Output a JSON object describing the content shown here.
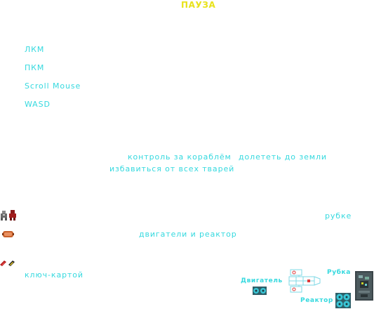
{
  "title": "ПАУЗА",
  "controls": [
    {
      "key": "ЛКМ"
    },
    {
      "key": "ПКМ"
    },
    {
      "key": "Scroll Mouse"
    },
    {
      "key": "WASD"
    }
  ],
  "goals": {
    "control": "контроль за кораблём",
    "fly": "долететь до земли",
    "kill": "избавиться от всех тварей"
  },
  "hints": {
    "cabin": "рубке",
    "engines": "двигатели и реактор",
    "keycard": "ключ-картой"
  },
  "diagram": {
    "engine_label": "Двигатель",
    "cabin_label": "Рубка",
    "reactor_label": "Реактор"
  },
  "icons": [
    "robot-icon",
    "mutant-icon",
    "engine-icon",
    "keycard-red-icon",
    "keycard-yellow-icon",
    "reactor-icon",
    "cockpit-icon",
    "ship-schematic-icon"
  ]
}
